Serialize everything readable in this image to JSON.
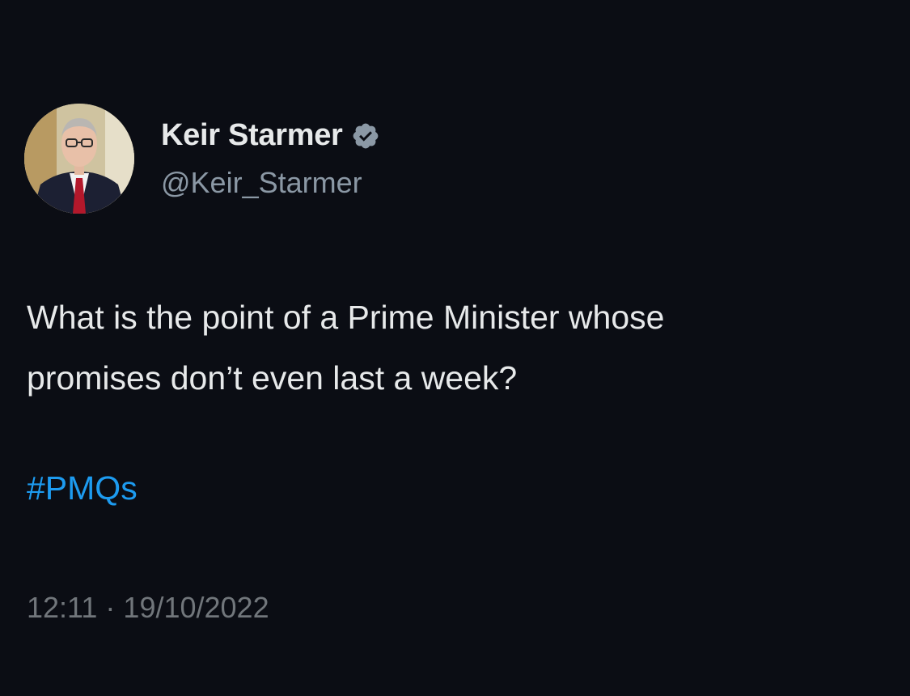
{
  "author": {
    "display_name": "Keir Starmer",
    "handle": "@Keir_Starmer",
    "verified_icon": "verified-badge-icon",
    "avatar": "profile-photo"
  },
  "tweet": {
    "text": "What is the point of a Prime Minister whose\npromises don’t even last a week?",
    "hashtag": "#PMQs",
    "time": "12:11",
    "separator": "·",
    "date": "19/10/2022"
  },
  "colors": {
    "background": "#0b0d14",
    "text": "#e7e9ea",
    "handle": "#8b98a5",
    "link": "#1d9bf0",
    "timestamp": "#71767b"
  }
}
